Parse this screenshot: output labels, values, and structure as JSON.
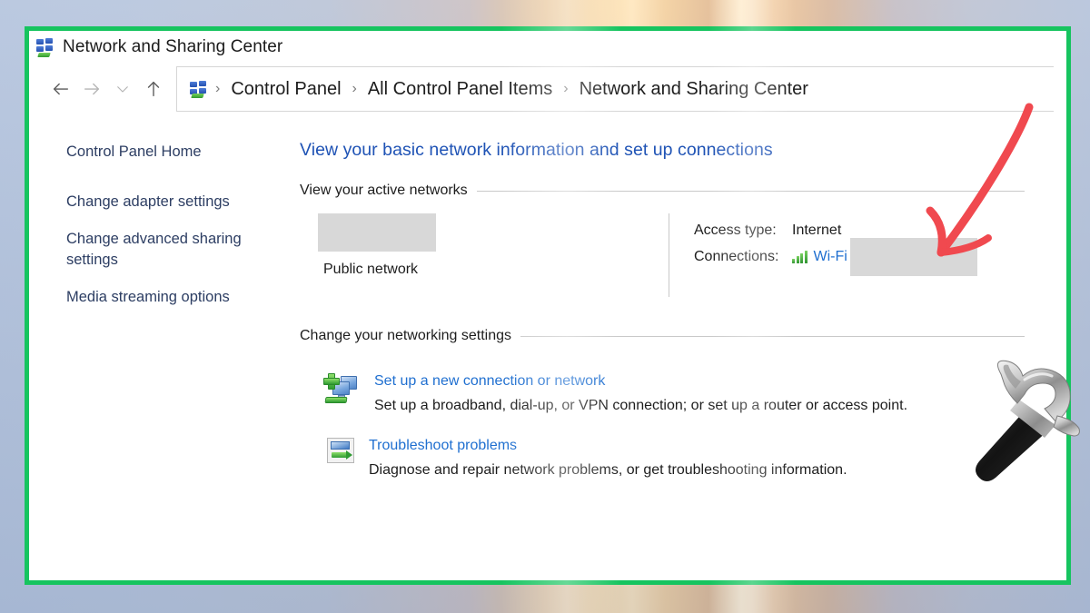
{
  "window": {
    "title": "Network and Sharing Center",
    "title_icon": "windows-network-icon"
  },
  "nav": {
    "back_icon": "arrow-left-icon",
    "forward_icon": "arrow-right-icon",
    "recent_icon": "chevron-down-icon",
    "up_icon": "arrow-up-icon",
    "address_icon": "windows-network-icon",
    "separator": "›",
    "breadcrumbs": [
      "Control Panel",
      "All Control Panel Items",
      "Network and Sharing Center"
    ]
  },
  "sidebar": {
    "items": [
      {
        "label": "Control Panel Home"
      },
      {
        "label": "Change adapter settings"
      },
      {
        "label": "Change advanced sharing settings"
      },
      {
        "label": "Media streaming options"
      }
    ]
  },
  "main": {
    "heading": "View your basic network information and set up connections",
    "active_networks": {
      "section_label": "View your active networks",
      "network_name_redacted": "",
      "network_type": "Public network",
      "details": [
        {
          "key": "Access type:",
          "value": "Internet"
        },
        {
          "key": "Connections:",
          "value": "Wi-Fi (",
          "icon": "wifi-signal-icon",
          "redacted": true
        }
      ]
    },
    "networking_settings": {
      "section_label": "Change your networking settings",
      "tasks": [
        {
          "icon": "setup-connection-icon",
          "link": "Set up a new connection or network",
          "description": "Set up a broadband, dial-up, or VPN connection; or set up a router or access point."
        },
        {
          "icon": "troubleshoot-icon",
          "link": "Troubleshoot problems",
          "description": "Diagnose and repair network problems, or get troubleshooting information."
        }
      ]
    }
  },
  "annotations": {
    "arrow": {
      "name": "red-pointer-arrow",
      "color": "#f0494f"
    },
    "hammer": {
      "name": "hammer-illustration"
    },
    "highlight_frame_color": "#16c45f"
  }
}
